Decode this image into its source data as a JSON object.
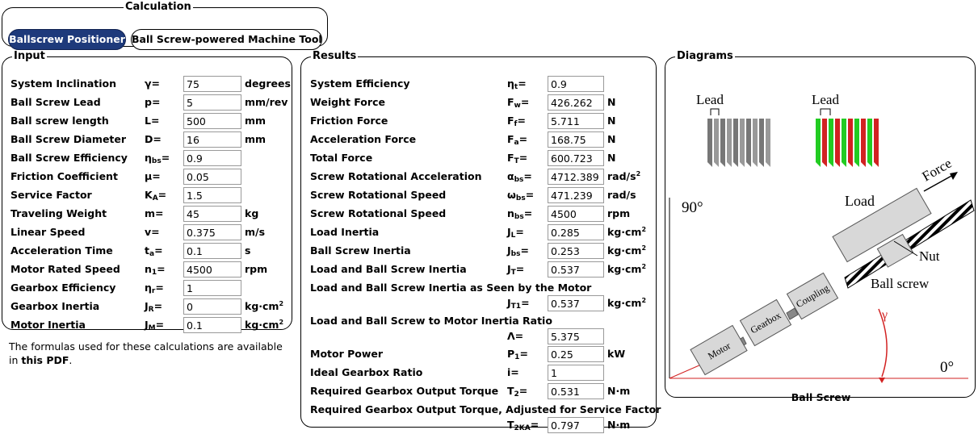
{
  "calculation": {
    "legend": "Calculation",
    "tabs": [
      {
        "label": "Ballscrew Positioner",
        "active": true
      },
      {
        "label": "Ball Screw-powered Machine Tool",
        "active": false
      }
    ]
  },
  "input": {
    "legend": "Input",
    "rows": [
      {
        "label": "System Inclination",
        "sym": "γ=",
        "value": "75",
        "unit": "degrees"
      },
      {
        "label": "Ball Screw Lead",
        "sym": "p=",
        "value": "5",
        "unit": "mm/rev"
      },
      {
        "label": "Ball screw length",
        "sym": "L=",
        "value": "500",
        "unit": "mm"
      },
      {
        "label": "Ball Screw Diameter",
        "sym": "D=",
        "value": "16",
        "unit": "mm"
      },
      {
        "label": "Ball Screw Efficiency",
        "sym": "η",
        "sub": "bs",
        "eq": "=",
        "value": "0.9",
        "unit": ""
      },
      {
        "label": "Friction Coefficient",
        "sym": "μ=",
        "value": "0.05",
        "unit": ""
      },
      {
        "label": "Service Factor",
        "sym": "K",
        "sub": "A",
        "eq": "=",
        "value": "1.5",
        "unit": ""
      },
      {
        "label": "Traveling Weight",
        "sym": "m=",
        "value": "45",
        "unit": "kg"
      },
      {
        "label": "Linear Speed",
        "sym": "v=",
        "value": "0.375",
        "unit": "m/s"
      },
      {
        "label": "Acceleration Time",
        "sym": "t",
        "sub": "a",
        "eq": "=",
        "value": "0.1",
        "unit": "s"
      },
      {
        "label": "Motor Rated Speed",
        "sym": "n",
        "sub": "1",
        "eq": "=",
        "value": "4500",
        "unit": "rpm"
      },
      {
        "label": "Gearbox Efficiency",
        "sym": "η",
        "sub": "r",
        "eq": "=",
        "value": "1",
        "unit": ""
      },
      {
        "label": "Gearbox Inertia",
        "sym": "J",
        "sub": "R",
        "eq": "=",
        "value": "0",
        "unit": "kg·cm",
        "unit_sup": "2"
      },
      {
        "label": "Motor Inertia",
        "sym": "J",
        "sub": "M",
        "eq": "=",
        "value": "0.1",
        "unit": "kg·cm",
        "unit_sup": "2"
      }
    ]
  },
  "note": {
    "text": "The formulas used for these calculations are available in",
    "link": "this PDF",
    "end": "."
  },
  "results": {
    "legend": "Results",
    "rows": [
      {
        "label": "System Efficiency",
        "sym": "η",
        "sub": "t",
        "eq": "=",
        "value": "0.9",
        "unit": ""
      },
      {
        "label": "Weight Force",
        "sym": "F",
        "sub": "w",
        "eq": "=",
        "value": "426.262",
        "unit": "N"
      },
      {
        "label": "Friction Force",
        "sym": "F",
        "sub": "f",
        "eq": "=",
        "value": "5.711",
        "unit": "N"
      },
      {
        "label": "Acceleration Force",
        "sym": "F",
        "sub": "a",
        "eq": "=",
        "value": "168.75",
        "unit": "N"
      },
      {
        "label": "Total Force",
        "sym": "F",
        "sub": "T",
        "eq": "=",
        "value": "600.723",
        "unit": "N"
      },
      {
        "label": "Screw Rotational Acceleration",
        "sym": "α",
        "sub": "bs",
        "eq": "=",
        "value": "4712.389",
        "unit": "rad/s",
        "unit_sup": "2"
      },
      {
        "label": "Screw Rotational Speed",
        "sym": "ω",
        "sub": "bs",
        "eq": "=",
        "value": "471.239",
        "unit": "rad/s"
      },
      {
        "label": "Screw Rotational Speed",
        "sym": "n",
        "sub": "bs",
        "eq": "=",
        "value": "4500",
        "unit": "rpm"
      },
      {
        "label": "Load Inertia",
        "sym": "J",
        "sub": "L",
        "eq": "=",
        "value": "0.285",
        "unit": "kg·cm",
        "unit_sup": "2"
      },
      {
        "label": "Ball Screw Inertia",
        "sym": "J",
        "sub": "bs",
        "eq": "=",
        "value": "0.253",
        "unit": "kg·cm",
        "unit_sup": "2"
      },
      {
        "label": "Load and Ball Screw Inertia",
        "sym": "J",
        "sub": "T",
        "eq": "=",
        "value": "0.537",
        "unit": "kg·cm",
        "unit_sup": "2"
      }
    ],
    "rows2": [
      {
        "label": "Load and Ball Screw Inertia as Seen by the Motor",
        "sym": "J",
        "sub": "T1",
        "eq": "=",
        "value": "0.537",
        "unit": "kg·cm",
        "unit_sup": "2"
      },
      {
        "label": "Load and Ball Screw to Motor Inertia Ratio",
        "sym": "Λ=",
        "value": "5.375",
        "unit": ""
      }
    ],
    "rows3": [
      {
        "label": "Motor Power",
        "sym": "P",
        "sub": "1",
        "eq": "=",
        "value": "0.25",
        "unit": "kW"
      },
      {
        "label": "Ideal Gearbox Ratio",
        "sym": "i=",
        "value": "1",
        "unit": ""
      },
      {
        "label": "Required Gearbox Output Torque",
        "sym": "T",
        "sub": "2",
        "eq": "=",
        "value": "0.531",
        "unit": "N·m"
      }
    ],
    "rows4": [
      {
        "label": "Required Gearbox Output Torque, Adjusted for Service Factor",
        "sym": "T",
        "sub": "2KA",
        "eq": "=",
        "value": "0.797",
        "unit": "N·m"
      }
    ]
  },
  "diagrams": {
    "legend": "Diagrams",
    "lead_left": "Lead",
    "lead_right": "Lead",
    "force": "Force",
    "load": "Load",
    "nut": "Nut",
    "ball_screw": "Ball screw",
    "coupling": "Coupling",
    "gearbox": "Gearbox",
    "motor": "Motor",
    "angle_90": "90°",
    "angle_0": "0°",
    "gamma": "γ",
    "caption": "Ball Screw",
    "colors": {
      "accent_red": "#d22222",
      "thread_green": "#22cc22",
      "tab_active": "#1e3a7b"
    }
  }
}
